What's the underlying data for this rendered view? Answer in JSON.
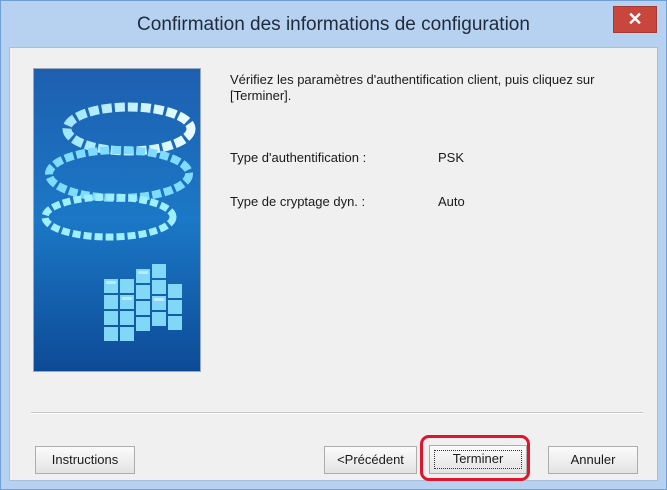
{
  "window": {
    "title": "Confirmation des informations de configuration",
    "close_label": "✕"
  },
  "main": {
    "message": "Vérifiez les paramètres d'authentification client, puis cliquez sur [Terminer].",
    "rows": [
      {
        "label": "Type d'authentification :",
        "value": "PSK"
      },
      {
        "label": "Type de cryptage dyn. :",
        "value": "Auto"
      }
    ]
  },
  "buttons": {
    "instructions": "Instructions",
    "previous": "<Précédent",
    "finish": "Terminer",
    "cancel": "Annuler"
  },
  "colors": {
    "titlebar": "#b7d2f0",
    "close_button": "#c9463d",
    "highlight": "#e0142a"
  },
  "icons": {
    "close": "close-icon",
    "illustration": "wireless-setup-illustration"
  }
}
